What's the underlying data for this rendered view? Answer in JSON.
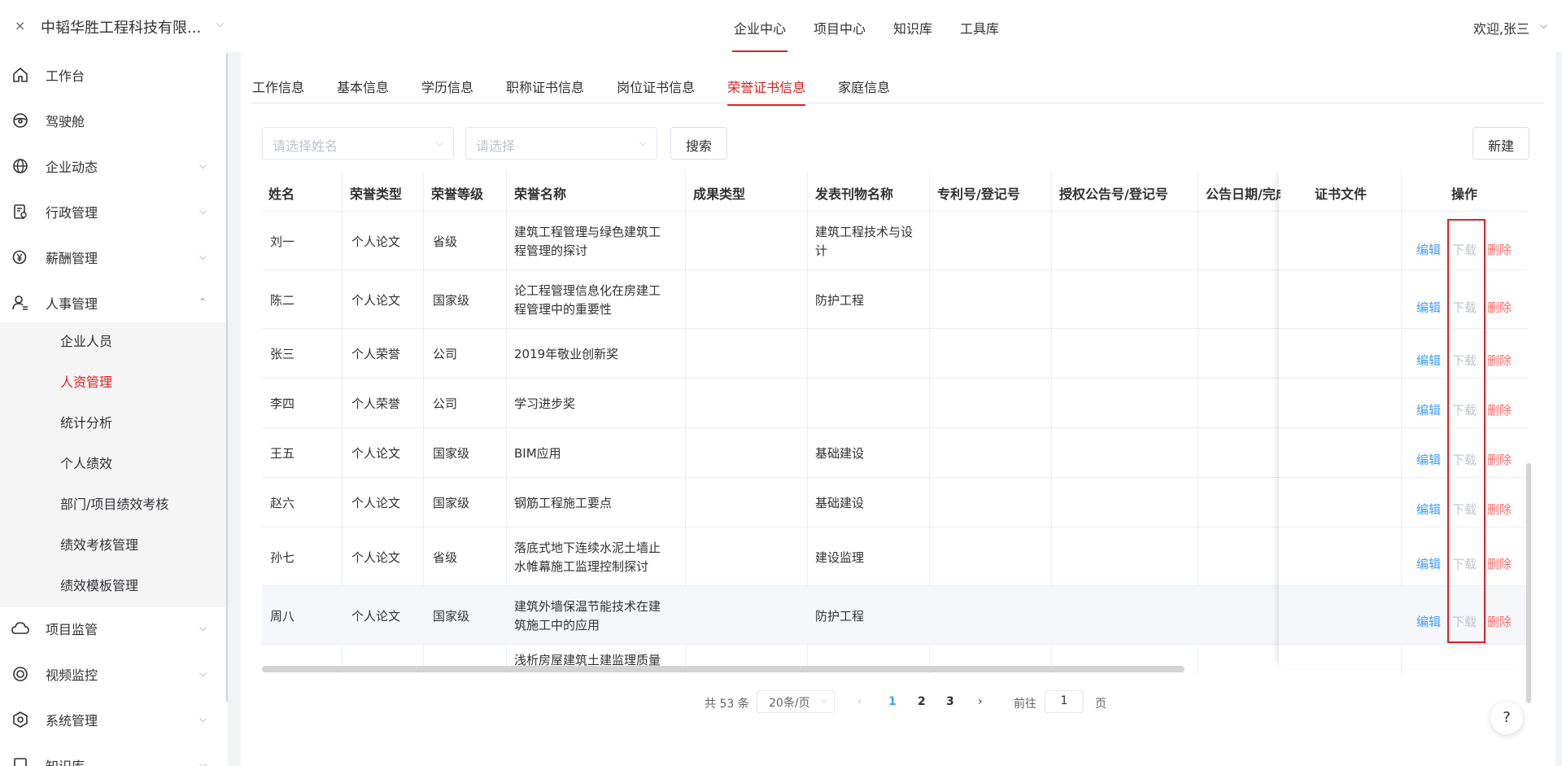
{
  "header": {
    "close_icon": "×",
    "company": "中韬华胜工程科技有限...",
    "nav": [
      "企业中心",
      "项目中心",
      "知识库",
      "工具库"
    ],
    "active_nav": "企业中心",
    "welcome": "欢迎,张三"
  },
  "sidebar": {
    "items": [
      {
        "label": "工作台",
        "icon": "home-icon"
      },
      {
        "label": "驾驶舱",
        "icon": "steering-wheel-icon"
      },
      {
        "label": "企业动态",
        "icon": "globe-icon"
      },
      {
        "label": "行政管理",
        "icon": "document-settings-icon"
      },
      {
        "label": "薪酬管理",
        "icon": "yen-icon"
      },
      {
        "label": "人事管理",
        "icon": "user-settings-icon"
      },
      {
        "label": "项目监管",
        "icon": "cloud-icon"
      },
      {
        "label": "视频监控",
        "icon": "camera-icon"
      },
      {
        "label": "系统管理",
        "icon": "hexagon-settings-icon"
      },
      {
        "label": "知识库",
        "icon": "book-icon"
      }
    ],
    "subitems": [
      "企业人员",
      "人资管理",
      "统计分析",
      "个人绩效",
      "部门/项目绩效考核",
      "绩效考核管理",
      "绩效模板管理"
    ],
    "active_subitem": "人资管理"
  },
  "tabs": [
    "工作信息",
    "基本信息",
    "学历信息",
    "职称证书信息",
    "岗位证书信息",
    "荣誉证书信息",
    "家庭信息"
  ],
  "active_tab": "荣誉证书信息",
  "filters": {
    "name_placeholder": "请选择姓名",
    "type_placeholder": "请选择",
    "search_label": "搜索",
    "new_label": "新建"
  },
  "table": {
    "columns": [
      "姓名",
      "荣誉类型",
      "荣誉等级",
      "荣誉名称",
      "成果类型",
      "发表刊物名称",
      "专利号/登记号",
      "授权公告号/登记号",
      "公告日期/完成",
      "证书文件",
      "操作"
    ],
    "rows": [
      {
        "name": "刘一",
        "type": "个人论文",
        "level": "省级",
        "title1": "建筑工程管理与绿色建筑工",
        "title2": "程管理的探讨",
        "journal1": "建筑工程技术与设",
        "journal2": "计"
      },
      {
        "name": "陈二",
        "type": "个人论文",
        "level": "国家级",
        "title1": "论工程管理信息化在房建工",
        "title2": "程管理中的重要性",
        "journal1": "防护工程",
        "journal2": ""
      },
      {
        "name": "张三",
        "type": "个人荣誉",
        "level": "公司",
        "title1": "2019年敬业创新奖",
        "title2": "",
        "journal1": "",
        "journal2": ""
      },
      {
        "name": "李四",
        "type": "个人荣誉",
        "level": "公司",
        "title1": "学习进步奖",
        "title2": "",
        "journal1": "",
        "journal2": ""
      },
      {
        "name": "王五",
        "type": "个人论文",
        "level": "国家级",
        "title1": "BIM应用",
        "title2": "",
        "journal1": "基础建设",
        "journal2": ""
      },
      {
        "name": "赵六",
        "type": "个人论文",
        "level": "国家级",
        "title1": "钢筋工程施工要点",
        "title2": "",
        "journal1": "基础建设",
        "journal2": ""
      },
      {
        "name": "孙七",
        "type": "个人论文",
        "level": "省级",
        "title1": "落底式地下连续水泥土墙止",
        "title2": "水帷幕施工监理控制探讨",
        "journal1": "建设监理",
        "journal2": ""
      },
      {
        "name": "周八",
        "type": "个人论文",
        "level": "国家级",
        "title1": "建筑外墙保温节能技术在建",
        "title2": "筑施工中的应用",
        "journal1": "防护工程",
        "journal2": ""
      },
      {
        "name": "",
        "type": "",
        "level": "",
        "title1": "浅析房屋建筑土建监理质量",
        "title2": "",
        "journal1": "",
        "journal2": ""
      }
    ],
    "actions": {
      "edit": "编辑",
      "download": "下载",
      "delete": "删除"
    }
  },
  "pagination": {
    "total": "共 53 条",
    "page_size": "20条/页",
    "pages": [
      "1",
      "2",
      "3"
    ],
    "current": "1",
    "goto_prefix": "前往",
    "goto_value": "1",
    "goto_suffix": "页"
  },
  "help": "?"
}
